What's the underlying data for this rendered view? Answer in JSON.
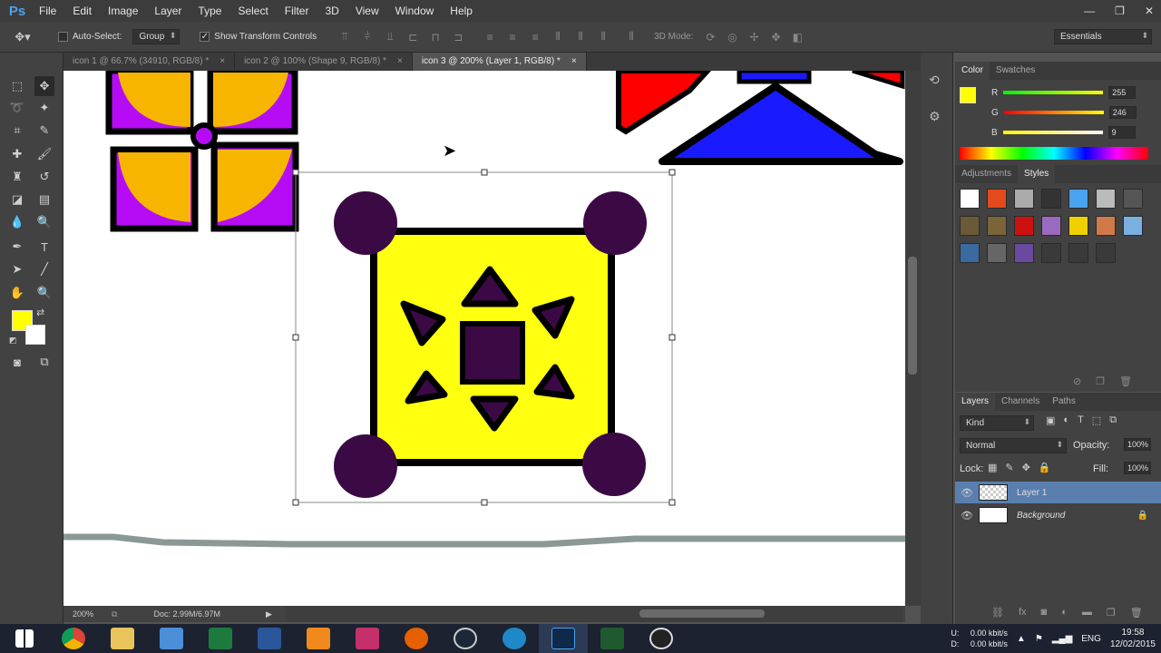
{
  "app": {
    "logo": "Ps"
  },
  "menu": [
    "File",
    "Edit",
    "Image",
    "Layer",
    "Type",
    "Select",
    "Filter",
    "3D",
    "View",
    "Window",
    "Help"
  ],
  "window_controls": {
    "minimize": "—",
    "restore": "❐",
    "close": "✕"
  },
  "options_bar": {
    "auto_select_label": "Auto-Select:",
    "auto_select_value": "Group",
    "show_transform_label": "Show Transform Controls",
    "mode_3d_label": "3D Mode:",
    "workspace": "Essentials"
  },
  "tabs": [
    {
      "label": "icon 1 @ 66.7% (34910, RGB/8) *",
      "close": "×"
    },
    {
      "label": "icon 2 @ 100% (Shape 9, RGB/8) *",
      "close": "×"
    },
    {
      "label": "icon 3 @ 200% (Layer 1, RGB/8) *",
      "close": "×"
    }
  ],
  "status": {
    "zoom": "200%",
    "doc": "Doc: 2.99M/6.97M"
  },
  "colors": {
    "foreground": "#ffff00",
    "background": "#ffffff",
    "purple": "#3b0a45",
    "yellow": "#ffff10",
    "orange": "#f7b500",
    "violet": "#b60cf5",
    "red": "#ff0000",
    "blue": "#1a1aff",
    "gray_line": "#8a9896"
  },
  "color_panel": {
    "tabs": [
      "Color",
      "Swatches"
    ],
    "r_label": "R",
    "r_value": "255",
    "g_label": "G",
    "g_value": "246",
    "b_label": "B",
    "b_value": "9"
  },
  "styles_panel": {
    "tabs": [
      "Adjustments",
      "Styles"
    ]
  },
  "layers_panel": {
    "tabs": [
      "Layers",
      "Channels",
      "Paths"
    ],
    "filter": "Kind",
    "blend_mode": "Normal",
    "opacity_label": "Opacity:",
    "opacity_value": "100%",
    "lock_label": "Lock:",
    "fill_label": "Fill:",
    "fill_value": "100%",
    "layers": [
      {
        "name": "Layer 1",
        "visible_icon": "👁"
      },
      {
        "name": "Background",
        "visible_icon": "👁"
      }
    ]
  },
  "taskbar": {
    "apps": [
      "windows-start",
      "chrome",
      "file-explorer",
      "control-panel",
      "excel",
      "word",
      "vlc",
      "winamp",
      "firefox",
      "steam",
      "uplay",
      "photoshop",
      "monitor",
      "obs"
    ],
    "upload_label": "U:",
    "download_label": "D:",
    "upload": "0.00 kbit/s",
    "download": "0.00 kbit/s",
    "lang": "ENG",
    "time": "19:58",
    "date": "12/02/2015"
  }
}
